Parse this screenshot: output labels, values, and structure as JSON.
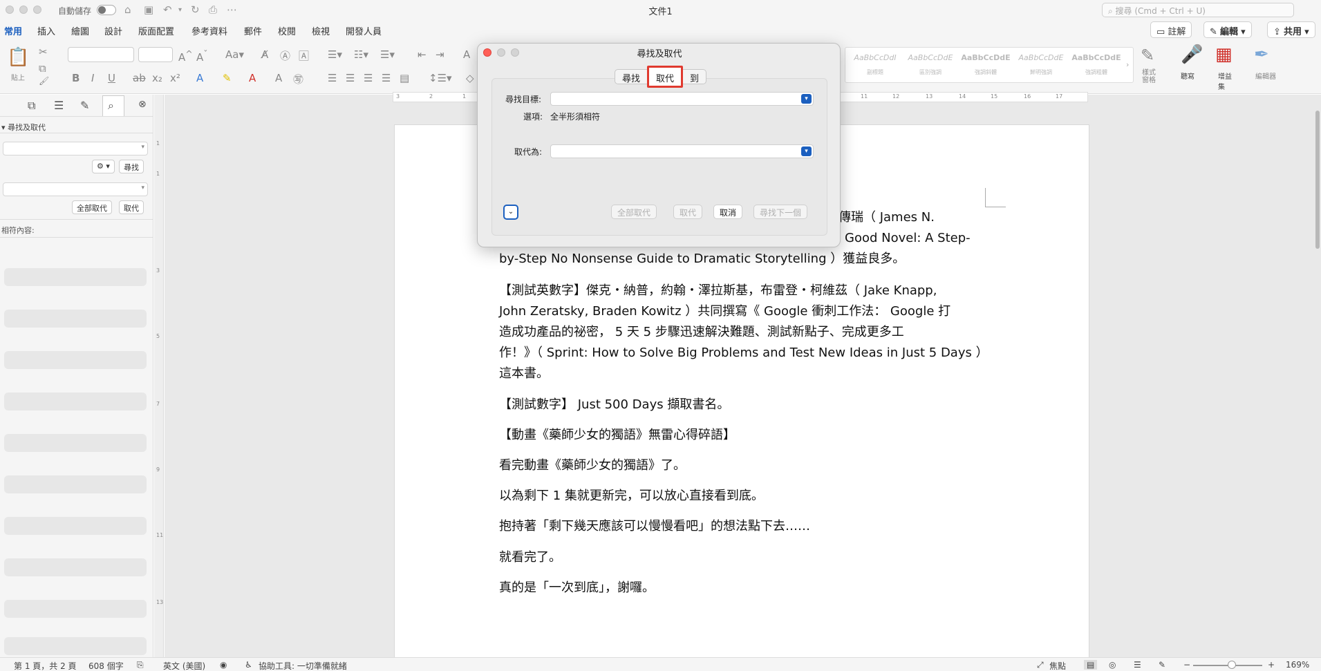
{
  "titlebar": {
    "autosave_label": "自動儲存",
    "document_title": "文件1",
    "search_placeholder": "搜尋 (Cmd + Ctrl + U)"
  },
  "tabs": [
    "常用",
    "插入",
    "繪圖",
    "設計",
    "版面配置",
    "參考資料",
    "郵件",
    "校閱",
    "檢視",
    "開發人員"
  ],
  "right_buttons": {
    "comments": "註解",
    "editing": "編輯",
    "share": "共用"
  },
  "ribbon": {
    "paste_label": "貼上",
    "styles": [
      {
        "sample": "AaBbCcDdI",
        "name": "副標題"
      },
      {
        "sample": "AaBbCcDdE",
        "name": "區別強調"
      },
      {
        "sample": "AaBbCcDdE",
        "name": "強調斜體"
      },
      {
        "sample": "AaBbCcDdE",
        "name": "鮮明強調"
      },
      {
        "sample": "AaBbCcDdE",
        "name": "強調粗體"
      }
    ],
    "style_pane_label": "樣式\n窗格",
    "dictate_label": "聽寫",
    "addins_label": "增益集",
    "editor_label": "編輯器"
  },
  "sidebar": {
    "section_title": "尋找及取代",
    "find_button": "尋找",
    "replace_all_button": "全部取代",
    "replace_button": "取代",
    "results_label": "相符內容:"
  },
  "dialog": {
    "title": "尋找及取代",
    "tabs": [
      "尋找",
      "取代",
      "到"
    ],
    "active_tab": "取代",
    "find_label": "尋找目標:",
    "options_label": "選項:",
    "options_value": "全半形須相符",
    "replace_label": "取代為:",
    "find_value": "",
    "replace_value": "",
    "btn_replace_all": "全部取代",
    "btn_replace": "取代",
    "btn_cancel": "取消",
    "btn_find_next": "尋找下一個"
  },
  "document": {
    "lines": [
      "傳瑞（ James N.",
      "Good Novel: A Step-",
      "by-Step No Nonsense Guide to Dramatic Storytelling ）獲益良多。",
      "【測試英數字】傑克・納普，約翰・澤拉斯基，布雷登・柯維茲（ Jake Knapp,",
      "John Zeratsky, Braden Kowitz ）共同撰寫《 Google 衝刺工作法： Google 打",
      "造成功產品的祕密， 5 天 5 步驟迅速解決難題、測試新點子、完成更多工",
      "作！》（ Sprint: How to Solve Big Problems and Test New Ideas in Just 5 Days ）",
      "這本書。",
      "【測試數字】 Just 500 Days 擷取書名。",
      "【動畫《藥師少女的獨語》無雷心得碎語】",
      "看完動畫《藥師少女的獨語》了。",
      "以為剩下 1 集就更新完，可以放心直接看到底。",
      "抱持著「剩下幾天應該可以慢慢看吧」的想法點下去……",
      "就看完了。",
      "真的是「一次到底」，謝囉。"
    ]
  },
  "statusbar": {
    "page": "第 1 頁，共 2 頁",
    "words": "608 個字",
    "language": "英文 (美國)",
    "accessibility": "協助工具: 一切準備就緒",
    "focus": "焦點",
    "zoom": "169%"
  },
  "colors": {
    "accent": "#1b5fbf",
    "highlight_box": "#e03a2f"
  }
}
